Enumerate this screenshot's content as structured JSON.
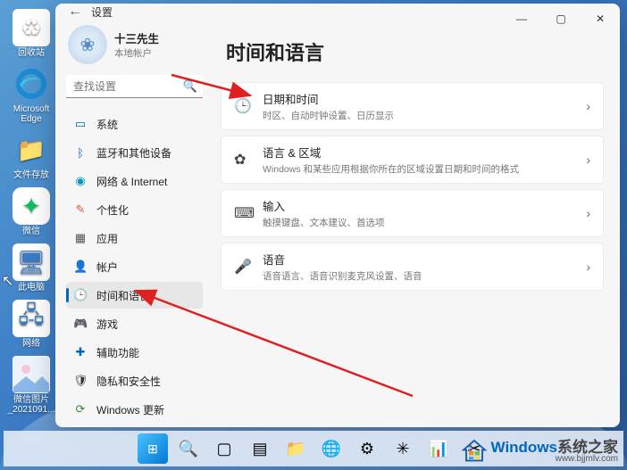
{
  "desktop": {
    "recycle": "回收站",
    "edge": "Microsoft Edge",
    "folder": "文件存放",
    "wechat": "微信",
    "thispc": "此电脑",
    "network": "网络",
    "pic": "微信图片_2021091..."
  },
  "window": {
    "title": "设置",
    "back_aria": "返回"
  },
  "profile": {
    "name": "十三先生",
    "type": "本地帐户"
  },
  "search": {
    "placeholder": "查找设置"
  },
  "nav": {
    "system": "系统",
    "bluetooth": "蓝牙和其他设备",
    "network": "网络 & Internet",
    "personalize": "个性化",
    "apps": "应用",
    "accounts": "帐户",
    "time": "时间和语言",
    "gaming": "游戏",
    "access": "辅助功能",
    "privacy": "隐私和安全性",
    "update": "Windows 更新"
  },
  "page": {
    "title": "时间和语言"
  },
  "cards": {
    "datetime": {
      "title": "日期和时间",
      "desc": "时区、自动时钟设置、日历显示"
    },
    "region": {
      "title": "语言 & 区域",
      "desc": "Windows 和某些应用根据你所在的区域设置日期和时间的格式"
    },
    "input": {
      "title": "输入",
      "desc": "触摸键盘、文本建议、首选项"
    },
    "voice": {
      "title": "语音",
      "desc": "语音语言、语音识别麦克风设置、语音"
    }
  },
  "watermark": {
    "brand1": "Windows",
    "brand2": "系统之家",
    "url": "www.bjjmlv.com"
  }
}
